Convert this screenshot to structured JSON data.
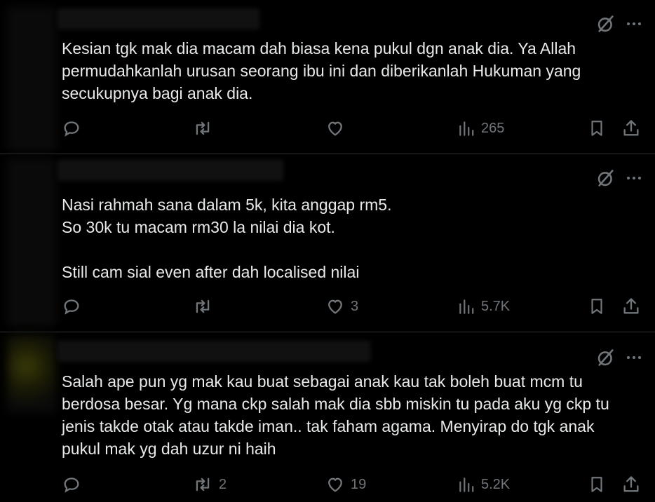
{
  "posts": [
    {
      "lines": [
        "Kesian tgk mak dia macam dah biasa kena pukul dgn anak dia. Ya Allah",
        "permudahkanlah urusan seorang ibu ini dan diberikanlah Hukuman yang",
        "secukupnya bagi anak dia."
      ],
      "stats": {
        "replies": "",
        "reposts": "",
        "likes": "",
        "views": "265"
      }
    },
    {
      "lines": [
        "Nasi rahmah sana dalam 5k, kita anggap rm5.",
        "So 30k tu macam rm30 la nilai dia kot.",
        "",
        "Still cam sial even after dah localised nilai"
      ],
      "stats": {
        "replies": "",
        "reposts": "",
        "likes": "3",
        "views": "5.7K"
      }
    },
    {
      "lines": [
        "Salah ape pun yg mak kau buat sebagai anak kau tak boleh buat mcm tu",
        "berdosa besar. Yg mana ckp salah mak dia sbb miskin tu pada aku yg ckp tu",
        "jenis takde otak atau takde iman.. tak faham agama. Menyirap do tgk anak",
        "pukul mak yg dah uzur ni haih"
      ],
      "stats": {
        "replies": "",
        "reposts": "2",
        "likes": "19",
        "views": "5.2K"
      }
    }
  ],
  "icons": {
    "grok": "grok-icon",
    "more": "more-icon",
    "reply": "reply-icon",
    "repost": "repost-icon",
    "like": "like-icon",
    "views": "views-icon",
    "bookmark": "bookmark-icon",
    "share": "share-icon"
  },
  "colors": {
    "background": "#000000",
    "text": "#e7e9ea",
    "muted": "#71767b",
    "divider": "#2f3336"
  }
}
